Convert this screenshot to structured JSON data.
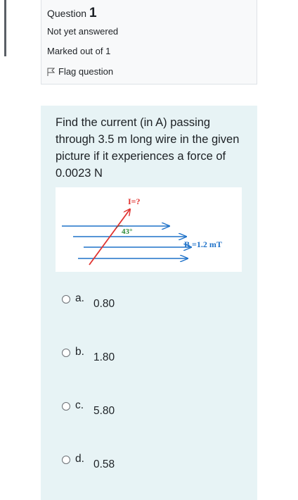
{
  "info": {
    "question_label": "Question",
    "question_number": "1",
    "status": "Not yet answered",
    "marks": "Marked out of 1",
    "flag_label": "Flag question"
  },
  "question": {
    "text": "Find the current (in A) passing through 3.5 m long wire in the given picture if it experiences a force of 0.0023 N",
    "figure": {
      "current_label": "I=?",
      "angle_label": "43°",
      "field_label": "B =1.2 mT"
    }
  },
  "answers": [
    {
      "letter": "a.",
      "value": "0.80"
    },
    {
      "letter": "b.",
      "value": "1.80"
    },
    {
      "letter": "c.",
      "value": "5.80"
    },
    {
      "letter": "d.",
      "value": "0.58"
    }
  ],
  "colors": {
    "wire": "#e0322f",
    "field_lines": "#1f72c9",
    "content_bg": "#e7f3f5",
    "info_bg": "#f8f9fa"
  }
}
